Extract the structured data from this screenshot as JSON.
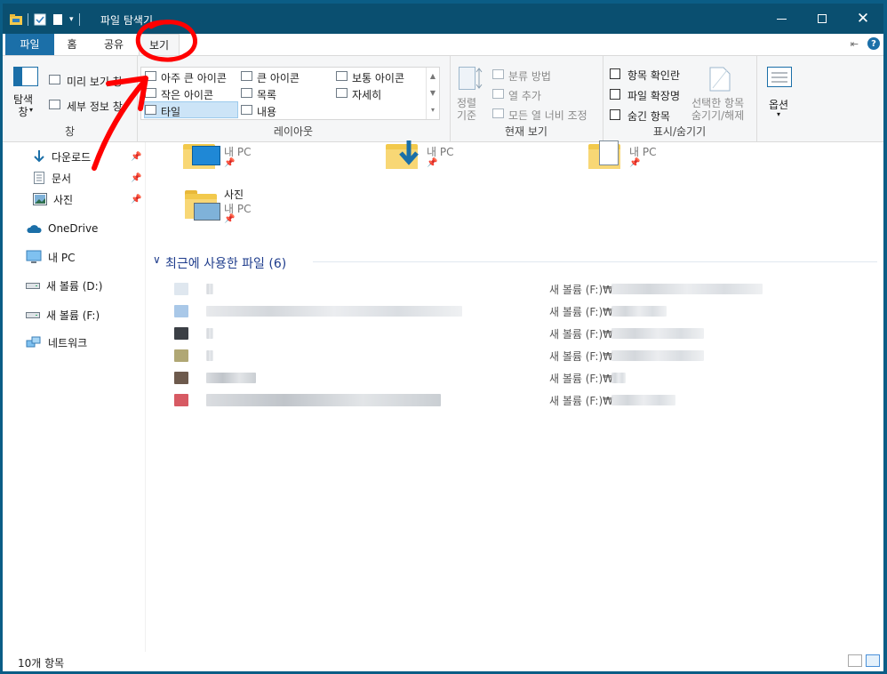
{
  "window": {
    "title": "파일 탐색기"
  },
  "tabs": [
    {
      "label": "파일"
    },
    {
      "label": "홈"
    },
    {
      "label": "공유"
    },
    {
      "label": "보기"
    }
  ],
  "ribbon": {
    "pane_group": {
      "label": "창",
      "nav_pane": "탐색\n창",
      "preview_pane": "미리 보기 창",
      "details_pane": "세부 정보 창"
    },
    "layout_group": {
      "label": "레이아웃",
      "items": [
        "아주 큰 아이콘",
        "큰 아이콘",
        "보통 아이콘",
        "작은 아이콘",
        "목록",
        "자세히",
        "타일",
        "내용"
      ],
      "selected": "타일"
    },
    "current_view_group": {
      "label": "현재 보기",
      "sort_by": "정렬\n기준",
      "group_by": "분류 방법",
      "add_columns": "열 추가",
      "size_columns": "모든 열 너비 조정"
    },
    "show_hide_group": {
      "label": "표시/숨기기",
      "checkboxes": [
        "항목 확인란",
        "파일 확장명",
        "숨긴 항목"
      ],
      "hide_selected": "선택한 항목\n숨기기/해제"
    },
    "options": {
      "label": "옵션"
    }
  },
  "nav": {
    "quick": [
      {
        "label": "다운로드",
        "icon": "download-arrow-icon",
        "pinned": true
      },
      {
        "label": "문서",
        "icon": "document-icon",
        "pinned": true
      },
      {
        "label": "사진",
        "icon": "picture-icon",
        "pinned": true
      }
    ],
    "onedrive": "OneDrive",
    "this_pc": "내 PC",
    "drives": [
      "새 볼륨 (D:)",
      "새 볼륨 (F:)"
    ],
    "network": "네트워크"
  },
  "content": {
    "tiles": [
      {
        "name": "",
        "sub": "내 PC"
      },
      {
        "name": "",
        "sub": "내 PC"
      },
      {
        "name": "",
        "sub": "내 PC"
      },
      {
        "name": "사진",
        "sub": "내 PC"
      }
    ],
    "recent_header": "최근에 사용한 파일 (6)",
    "recent_files": [
      {
        "location": "새 볼륨 (F:)₩",
        "icon_color": "#dfe7ef"
      },
      {
        "location": "새 볼륨 (F:)₩",
        "icon_color": "#a9c8e8"
      },
      {
        "location": "새 볼륨 (F:)₩",
        "icon_color": "#3b3f45"
      },
      {
        "location": "새 볼륨 (F:)₩",
        "icon_color": "#b0a774"
      },
      {
        "location": "새 볼륨 (F:)₩",
        "icon_color": "#6d5a4d"
      },
      {
        "location": "새 볼륨 (F:)₩",
        "icon_color": "#d75a63"
      }
    ]
  },
  "status": {
    "count": "10개 항목"
  },
  "annotation": {
    "color": "#ff0000"
  }
}
